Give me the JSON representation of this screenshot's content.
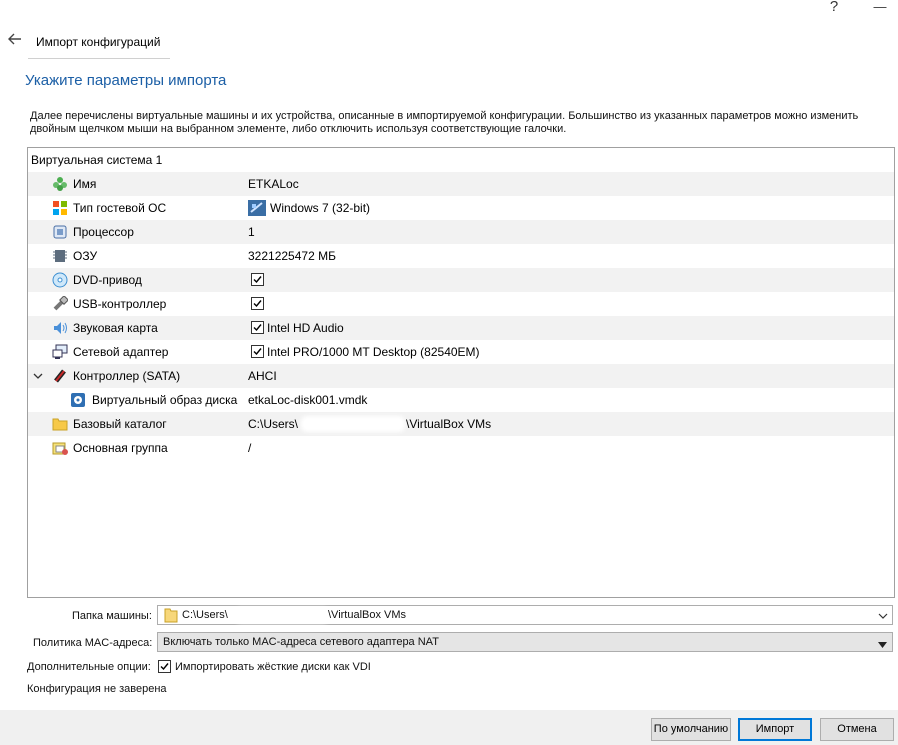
{
  "titlebar": {
    "help": "?",
    "close": "—"
  },
  "wizard": {
    "tab_title": "Импорт конфигураций",
    "page_title": "Укажите параметры импорта",
    "description": "Далее перечислены виртуальные машины и их устройства, описанные в импортируемой конфигурации. Большинство из указанных параметров можно изменить двойным щелчком мыши на выбранном элементе, либо отключить используя соответствующие галочки."
  },
  "tree": {
    "header": "Виртуальная система 1",
    "rows": [
      {
        "label": "Имя",
        "value": "ETKALoc",
        "icon": "name-icon"
      },
      {
        "label": "Тип гостевой ОС",
        "value": "Windows 7 (32-bit)",
        "icon": "os-type-icon"
      },
      {
        "label": "Процессор",
        "value": "1",
        "icon": "processor-icon"
      },
      {
        "label": "ОЗУ",
        "value": "3221225472 МБ",
        "icon": "ram-icon"
      },
      {
        "label": "DVD-привод",
        "value": "",
        "icon": "dvd-icon",
        "checked": true
      },
      {
        "label": "USB-контроллер",
        "value": "",
        "icon": "usb-icon",
        "checked": true
      },
      {
        "label": "Звуковая карта",
        "value": "Intel HD Audio",
        "icon": "audio-icon",
        "checked": true
      },
      {
        "label": "Сетевой адаптер",
        "value": "Intel PRO/1000 MT Desktop (82540EM)",
        "icon": "network-icon",
        "checked": true
      },
      {
        "label": "Контроллер (SATA)",
        "value": "AHCI",
        "icon": "sata-controller-icon"
      },
      {
        "label": "Виртуальный образ диска",
        "value": "etkaLoc-disk001.vmdk",
        "icon": "disk-image-icon"
      },
      {
        "label": "Базовый каталог",
        "value_prefix": "C:\\Users\\",
        "value_suffix": "\\VirtualBox VMs",
        "icon": "folder-icon"
      },
      {
        "label": "Основная группа",
        "value": "/",
        "icon": "group-icon"
      }
    ]
  },
  "options": {
    "machine_folder_label": "Папка машины:",
    "machine_folder_prefix": "C:\\Users\\",
    "machine_folder_suffix": "\\VirtualBox VMs",
    "mac_policy_label": "Политика MAC-адреса:",
    "mac_policy_value": "Включать только MAC-адреса сетевого адаптера NAT",
    "extra_label": "Дополнительные опции:",
    "import_vdi_label": "Импортировать жёсткие диски как VDI",
    "import_vdi_checked": true,
    "signature_status": "Конфигурация не заверена"
  },
  "buttons": {
    "defaults": "По умолчанию",
    "import": "Импорт",
    "cancel": "Отмена"
  }
}
